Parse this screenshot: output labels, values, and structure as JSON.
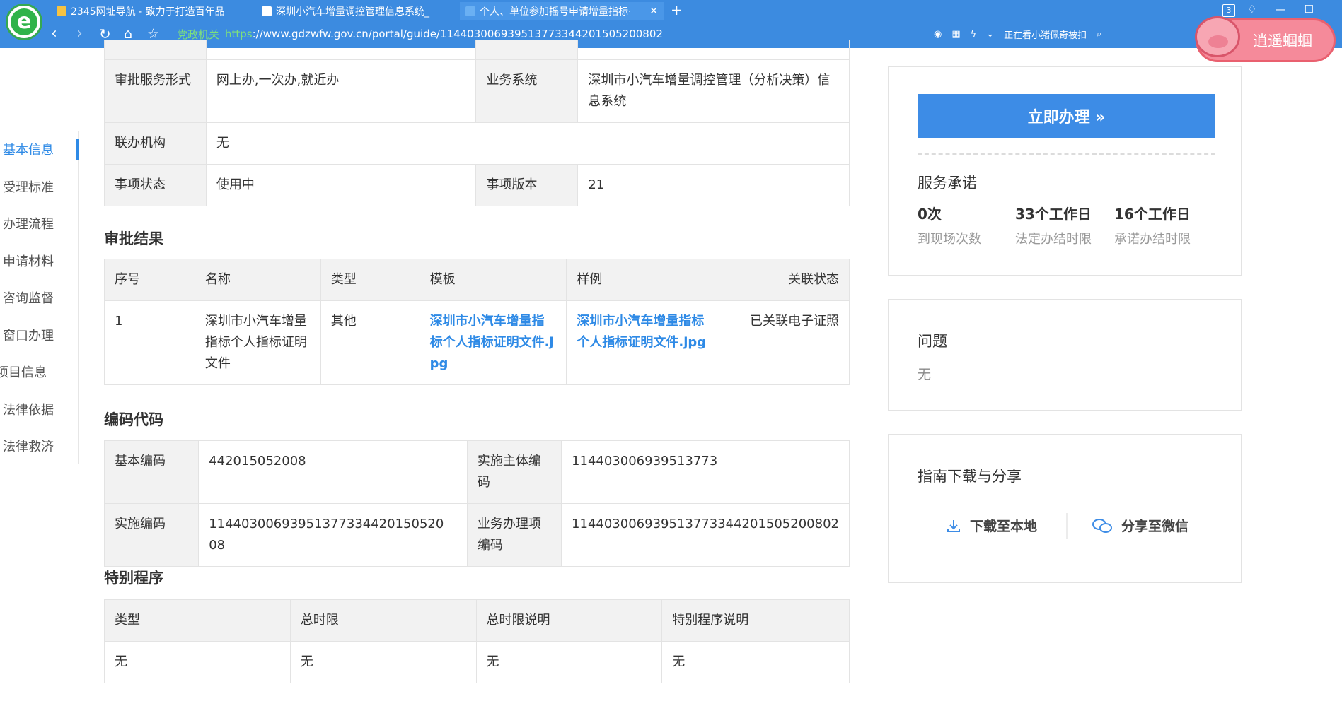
{
  "browser": {
    "tabs": [
      {
        "title": "2345网址导航 - 致力于打造百年品",
        "active": false
      },
      {
        "title": "深圳小汽车增量调控管理信息系统_",
        "active": false
      },
      {
        "title": "个人、单位参加摇号申请增量指标·",
        "active": true
      }
    ],
    "tab_count": "3",
    "gov_label": "党政机关",
    "url_https": "https",
    "url_rest": "://www.gdzwfw.gov.cn/portal/guide/11440300693951377334420150520080 2",
    "url": "://www.gdzwfw.gov.cn/portal/guide/114403006939513773344201505200802",
    "watching": "正在看小猪佩奇被扣",
    "badge_text": "逍遥蝈蝈"
  },
  "side_nav": [
    {
      "label": "基本信息",
      "active": true
    },
    {
      "label": "受理标准",
      "active": false
    },
    {
      "label": "办理流程",
      "active": false
    },
    {
      "label": "申请材料",
      "active": false
    },
    {
      "label": "咨询监督",
      "active": false
    },
    {
      "label": "窗口办理",
      "active": false
    },
    {
      "label": "项目信息",
      "active": false
    },
    {
      "label": "法律依据",
      "active": false
    },
    {
      "label": "法律救济",
      "active": false
    }
  ],
  "basic_info": {
    "service_form_label": "审批服务形式",
    "service_form_value": "网上办,一次办,就近办",
    "business_system_label": "业务系统",
    "business_system_value": "深圳市小汽车增量调控管理（分析决策）信息系统",
    "joint_org_label": "联办机构",
    "joint_org_value": "无",
    "status_label": "事项状态",
    "status_value": "使用中",
    "version_label": "事项版本",
    "version_value": "21"
  },
  "approval_result": {
    "title": "审批结果",
    "headers": [
      "序号",
      "名称",
      "类型",
      "模板",
      "样例",
      "关联状态"
    ],
    "row": {
      "index": "1",
      "name": "深圳市小汽车增量指标个人指标证明文件",
      "type": "其他",
      "template": "深圳市小汽车增量指标个人指标证明文件.jpg",
      "sample": "深圳市小汽车增量指标个人指标证明文件.jpg",
      "status": "已关联电子证照"
    }
  },
  "codes": {
    "title": "编码代码",
    "basic_code_label": "基本编码",
    "basic_code_value": "442015052008",
    "subject_code_label": "实施主体编码",
    "subject_code_value": "114403006939513773",
    "impl_code_label": "实施编码",
    "impl_code_value": "11440300693951377334420150520 08",
    "biz_code_label": "业务办理项编码",
    "biz_code_value": "114403006939513773344201505200802"
  },
  "special": {
    "title": "特别程序",
    "headers": [
      "类型",
      "总时限",
      "总时限说明",
      "特别程序说明"
    ],
    "row": [
      "无",
      "无",
      "无",
      "无"
    ]
  },
  "right": {
    "apply_label": "立即办理 »",
    "promise_title": "服务承诺",
    "stats": [
      {
        "value": "0次",
        "label": "到现场次数"
      },
      {
        "value": "33个工作日",
        "label": "法定办结时限"
      },
      {
        "value": "16个工作日",
        "label": "承诺办结时限"
      }
    ],
    "question_title": "问题",
    "question_value": "无",
    "guide_title": "指南下载与分享",
    "download_label": "下载至本地",
    "share_label": "分享至微信"
  }
}
